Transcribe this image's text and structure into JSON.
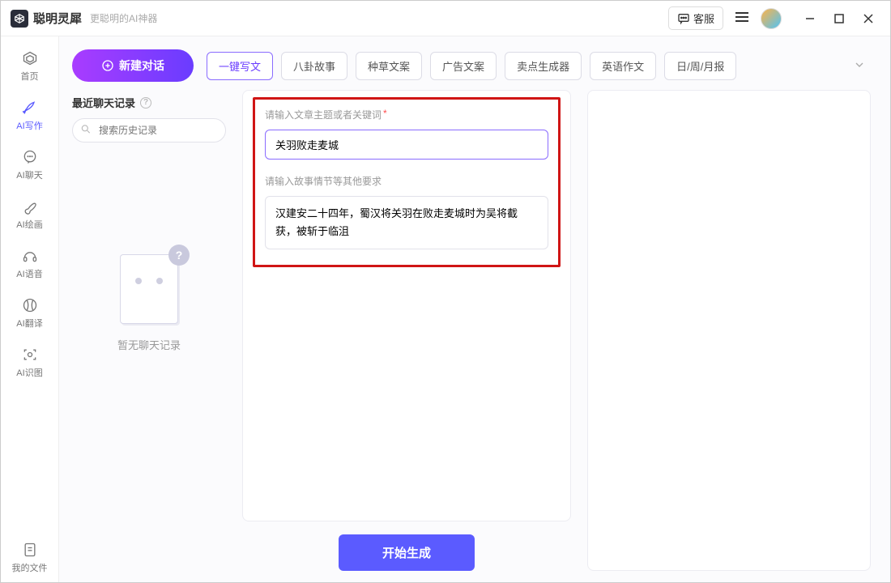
{
  "titlebar": {
    "app_name": "聪明灵犀",
    "subtitle": "更聪明的AI神器",
    "service_label": "客服"
  },
  "nav": {
    "items": [
      {
        "label": "首页",
        "icon": "home-icon"
      },
      {
        "label": "AI写作",
        "icon": "pen-icon"
      },
      {
        "label": "AI聊天",
        "icon": "chat-icon"
      },
      {
        "label": "AI绘画",
        "icon": "paint-icon"
      },
      {
        "label": "AI语音",
        "icon": "audio-icon"
      },
      {
        "label": "AI翻译",
        "icon": "translate-icon"
      },
      {
        "label": "AI识图",
        "icon": "vision-icon"
      }
    ],
    "files_label": "我的文件"
  },
  "toolbar": {
    "new_chat_label": "新建对话",
    "chips": [
      "一键写文",
      "八卦故事",
      "种草文案",
      "广告文案",
      "卖点生成器",
      "英语作文",
      "日/周/月报"
    ]
  },
  "history": {
    "heading": "最近聊天记录",
    "search_placeholder": "搜索历史记录",
    "empty_text": "暂无聊天记录"
  },
  "form": {
    "topic_label": "请输入文章主题或者关键词",
    "topic_value": "关羽败走麦城",
    "detail_label": "请输入故事情节等其他要求",
    "detail_value": "汉建安二十四年，蜀汉将关羽在败走麦城时为吴将截获，被斩于临沮",
    "submit_label": "开始生成"
  }
}
